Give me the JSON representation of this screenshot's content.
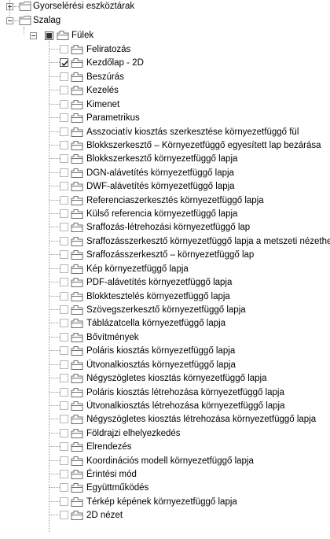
{
  "tree": {
    "quick_toolbar": {
      "label": "Gyorselérési eszköztárak",
      "expanded": false,
      "icon": "folder-icon"
    },
    "ribbon": {
      "label": "Szalag",
      "expanded": true,
      "icon": "folder-icon"
    },
    "tabs": {
      "label": "Fülek",
      "expanded": true,
      "check_state": "indeterminate",
      "icon": "tabs-folder-icon"
    },
    "items": [
      {
        "label": "Feliratozás",
        "checked": false
      },
      {
        "label": "Kezdőlap - 2D",
        "checked": true
      },
      {
        "label": "Beszúrás",
        "checked": false
      },
      {
        "label": "Kezelés",
        "checked": false
      },
      {
        "label": "Kimenet",
        "checked": false
      },
      {
        "label": "Parametrikus",
        "checked": false
      },
      {
        "label": "Asszociatív kiosztás szerkesztése környezetfüggő fül",
        "checked": false
      },
      {
        "label": "Blokkszerkesztő – Környezetfüggő egyesített lap bezárása",
        "checked": false
      },
      {
        "label": "Blokkszerkesztő környezetfüggő lapja",
        "checked": false
      },
      {
        "label": "DGN-alávetítés környezetfüggő lapja",
        "checked": false
      },
      {
        "label": "DWF-alávetítés környezetfüggő lapja",
        "checked": false
      },
      {
        "label": "Referenciaszerkesztés környezetfüggő lapja",
        "checked": false
      },
      {
        "label": "Külső referencia környezetfüggő lapja",
        "checked": false
      },
      {
        "label": "Sraffozás-létrehozási környezetfüggő lap",
        "checked": false
      },
      {
        "label": "Sraffozásszerkesztő környezetfüggő lapja a metszeti nézethez",
        "checked": false
      },
      {
        "label": "Sraffozásszerkesztő – környezetfüggő lap",
        "checked": false
      },
      {
        "label": "Kép környezetfüggő lapja",
        "checked": false
      },
      {
        "label": "PDF-alávetítés környezetfüggő lapja",
        "checked": false
      },
      {
        "label": "Blokktesztelés környezetfüggő lapja",
        "checked": false
      },
      {
        "label": "Szövegszerkesztő környezetfüggő lapja",
        "checked": false
      },
      {
        "label": "Táblázatcella környezetfüggő lapja",
        "checked": false
      },
      {
        "label": "Bővítmények",
        "checked": false
      },
      {
        "label": "Poláris kiosztás környezetfüggő lapja",
        "checked": false
      },
      {
        "label": "Útvonalkiosztás környezetfüggő lapja",
        "checked": false
      },
      {
        "label": "Négyszögletes kiosztás környezetfüggő lapja",
        "checked": false
      },
      {
        "label": "Poláris kiosztás létrehozása környezetfüggő lapja",
        "checked": false
      },
      {
        "label": "Útvonalkiosztás létrehozása környezetfüggő lapja",
        "checked": false
      },
      {
        "label": "Négyszögletes kiosztás létrehozása környezetfüggő lapja",
        "checked": false
      },
      {
        "label": "Földrajzi elhelyezkedés",
        "checked": false
      },
      {
        "label": "Elrendezés",
        "checked": false
      },
      {
        "label": "Koordinációs modell környezetfüggő lapja",
        "checked": false
      },
      {
        "label": "Érintési mód",
        "checked": false
      },
      {
        "label": "Együttműködés",
        "checked": false
      },
      {
        "label": "Térkép képének környezetfüggő lapja",
        "checked": false
      },
      {
        "label": "2D nézet",
        "checked": false
      }
    ]
  },
  "colors": {
    "folder": "#e8d08a",
    "folder_edge": "#9c8443",
    "tab_icon_edge": "#6e6e6e",
    "tree_line": "#9a9a9a"
  }
}
